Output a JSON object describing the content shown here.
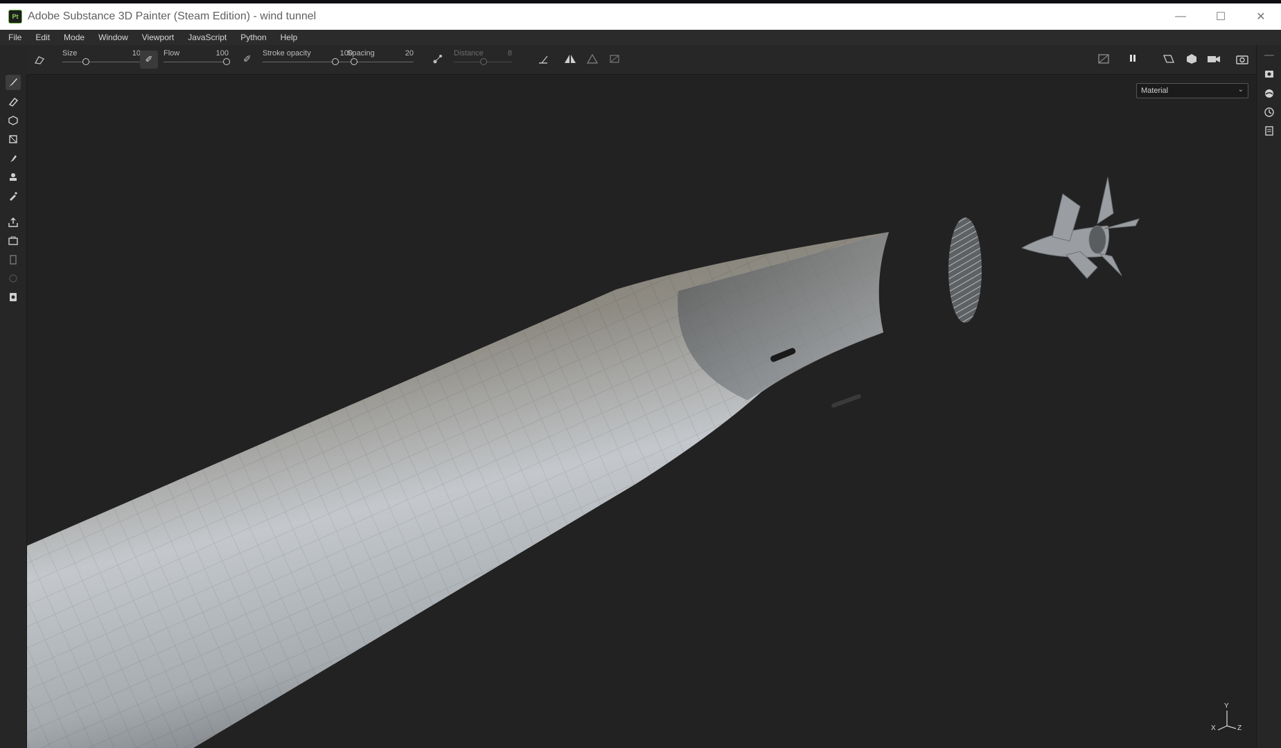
{
  "window": {
    "title": "Adobe Substance 3D Painter (Steam Edition) - wind tunnel",
    "app_icon_label": "Pt",
    "controls": {
      "minimize": "—",
      "maximize": "☐",
      "close": "✕"
    }
  },
  "menu": [
    "File",
    "Edit",
    "Mode",
    "Window",
    "Viewport",
    "JavaScript",
    "Python",
    "Help"
  ],
  "toolbar": {
    "size": {
      "label": "Size",
      "value": "10"
    },
    "flow": {
      "label": "Flow",
      "value": "100"
    },
    "stroke_opacity": {
      "label": "Stroke opacity",
      "value": "100"
    },
    "spacing": {
      "label": "Spacing",
      "value": "20"
    },
    "distance": {
      "label": "Distance",
      "value": "8"
    }
  },
  "viewport": {
    "channel_select": "Material",
    "axis": {
      "x": "X",
      "y": "Y",
      "z": "Z"
    }
  },
  "colors": {
    "accent_green": "#8fd35f",
    "viewport_bg": "#222222"
  }
}
